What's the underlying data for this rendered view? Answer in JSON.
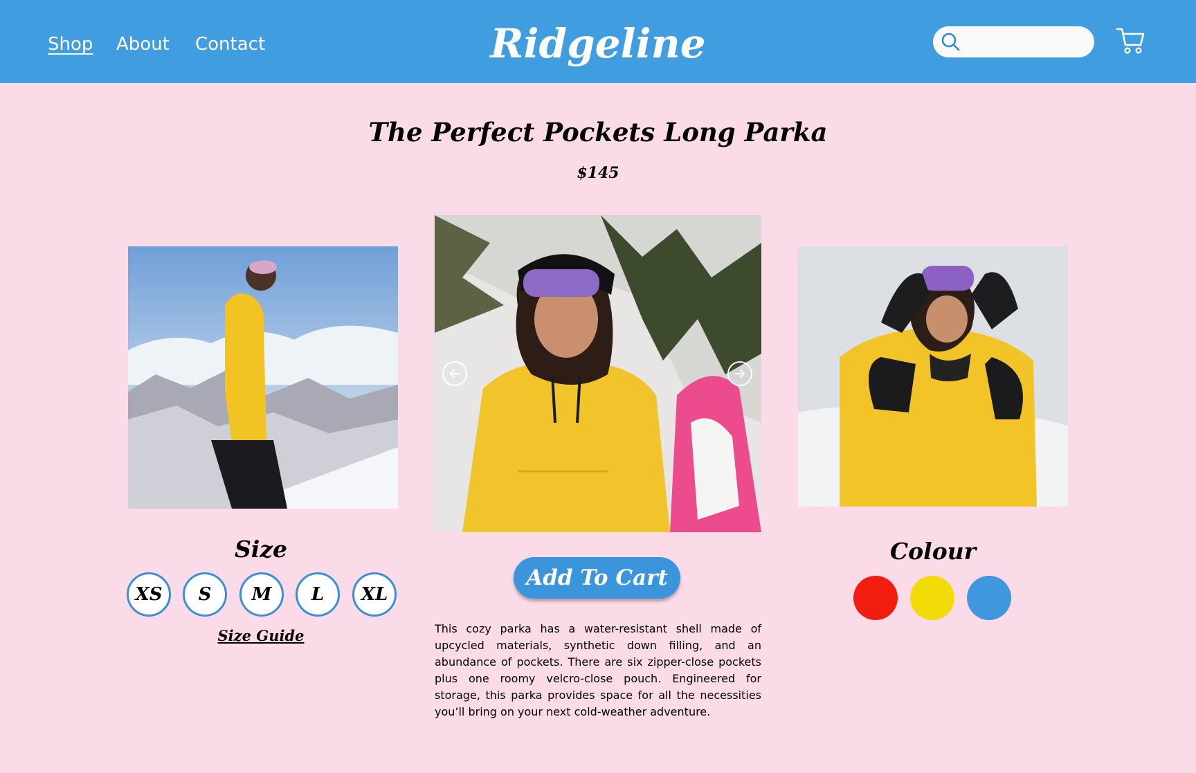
{
  "header": {
    "nav": [
      {
        "label": "Shop",
        "active": true
      },
      {
        "label": "About",
        "active": false
      },
      {
        "label": "Contact",
        "active": false
      }
    ],
    "logo": "Ridgeline",
    "search": {
      "placeholder": "",
      "value": "",
      "icon": "search-icon"
    },
    "cart_icon": "cart-icon"
  },
  "product": {
    "title": "The Perfect Pockets Long Parka",
    "price": "$145",
    "images": [
      {
        "role": "left",
        "subject": "woman in yellow parka on mountain"
      },
      {
        "role": "center",
        "subject": "woman in yellow parka smiling by snowy tree"
      },
      {
        "role": "right",
        "subject": "woman in yellow parka adjusting goggles"
      }
    ],
    "carousel": {
      "prev_icon": "arrow-left-icon",
      "next_icon": "arrow-right-icon"
    },
    "add_to_cart": "Add To Cart",
    "description": "This cozy parka has a water-resistant shell made of upcycled materials, synthetic down filling, and an abundance of pockets. There are six zipper-close pockets plus one roomy velcro-close pouch. Engineered for storage, this parka provides space for all the necessities you’ll bring on your next cold-weather adventure."
  },
  "size": {
    "heading": "Size",
    "options": [
      "XS",
      "S",
      "M",
      "L",
      "XL"
    ],
    "guide": "Size Guide"
  },
  "colour": {
    "heading": "Colour",
    "swatches": [
      "#f11d0f",
      "#f1dc08",
      "#3f98de"
    ]
  },
  "colors": {
    "header_bg": "#409ddf",
    "page_bg": "#fcdbe9",
    "accent": "#3b95dc"
  }
}
